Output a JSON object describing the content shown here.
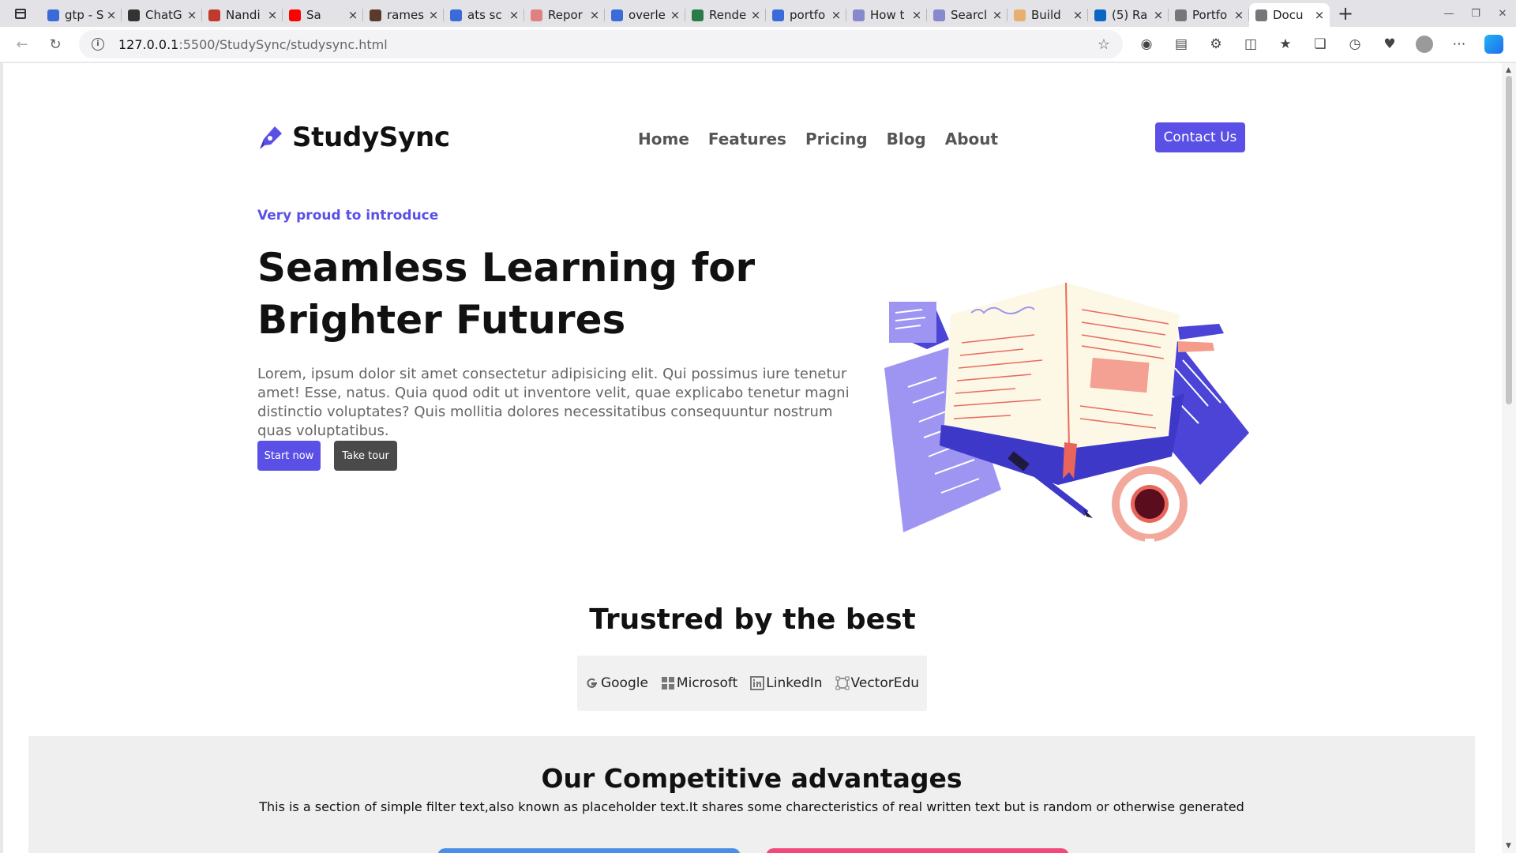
{
  "browser": {
    "tabs": [
      {
        "title": "gtp - S",
        "favicon": "search-favicon",
        "color": "#3b6bd6"
      },
      {
        "title": "ChatG",
        "favicon": "chatgpt-favicon",
        "color": "#333333"
      },
      {
        "title": "Nandi",
        "favicon": "pdf-favicon",
        "color": "#c0392b"
      },
      {
        "title": "Sa",
        "favicon": "youtube-favicon",
        "color": "#ff0000"
      },
      {
        "title": "rames",
        "favicon": "cc-favicon",
        "color": "#5a3b2a"
      },
      {
        "title": "ats sc",
        "favicon": "search-favicon",
        "color": "#3b6bd6"
      },
      {
        "title": "Repor",
        "favicon": "doc-favicon",
        "color": "#e08080"
      },
      {
        "title": "overle",
        "favicon": "search-favicon",
        "color": "#3b6bd6"
      },
      {
        "title": "Rende",
        "favicon": "render-favicon",
        "color": "#2a7a4a"
      },
      {
        "title": "portfo",
        "favicon": "search-favicon",
        "color": "#3b6bd6"
      },
      {
        "title": "How t",
        "favicon": "globe-favicon",
        "color": "#8888cc"
      },
      {
        "title": "Searcl",
        "favicon": "globe-favicon",
        "color": "#8888cc"
      },
      {
        "title": "Build",
        "favicon": "build-favicon",
        "color": "#e8b070"
      },
      {
        "title": "(5) Ra",
        "favicon": "linkedin-favicon",
        "color": "#0a66c2"
      },
      {
        "title": "Portfo",
        "favicon": "page-favicon",
        "color": "#777777"
      },
      {
        "title": "Docu",
        "favicon": "page-favicon",
        "color": "#777777",
        "active": true
      }
    ],
    "new_tab": "+",
    "url_host": "127.0.0.1",
    "url_rest": ":5500/StudySync/studysync.html"
  },
  "site": {
    "brand": "StudySync",
    "nav": [
      "Home",
      "Features",
      "Pricing",
      "Blog",
      "About"
    ],
    "contact": "Contact Us",
    "accent": "#5b50e6"
  },
  "hero": {
    "eyebrow": "Very proud to introduce",
    "title": "Seamless Learning for Brighter Futures",
    "description": "Lorem, ipsum dolor sit amet consectetur adipisicing elit. Qui possimus iure tenetur amet! Esse, natus. Quia quod odit ut inventore velit, quae explicabo tenetur magni distinctio voluptates? Quis mollitia dolores necessitatibus consequuntur nostrum quas voluptatibus.",
    "start": "Start now",
    "tour": "Take tour"
  },
  "trusted": {
    "title": "Trustred by the best",
    "brands": [
      {
        "name": "Google",
        "icon": "google-icon"
      },
      {
        "name": "Microsoft",
        "icon": "microsoft-icon"
      },
      {
        "name": "LinkedIn",
        "icon": "linkedin-icon"
      },
      {
        "name": "VectorEdu",
        "icon": "vector-icon"
      }
    ]
  },
  "advantages": {
    "title": "Our Competitive advantages",
    "subtitle": "This is a section of simple filter text,also known as placeholder text.It shares some charecteristics of real written text but is random or otherwise generated"
  }
}
